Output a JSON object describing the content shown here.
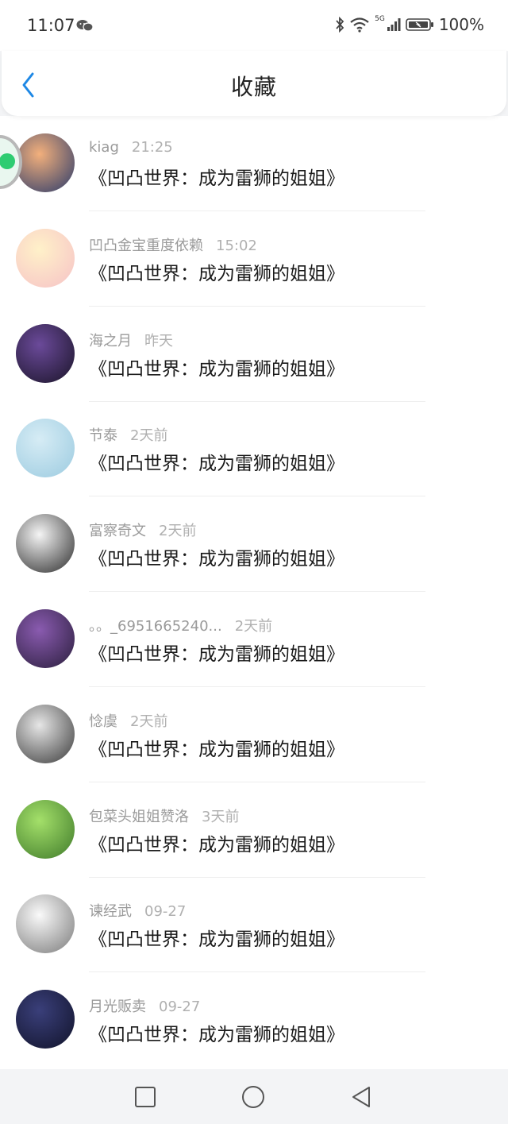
{
  "status_bar": {
    "time": "11:07",
    "battery_percent": "100%",
    "network": "5G",
    "icons": [
      "wechat-icon",
      "bluetooth-icon",
      "wifi-icon",
      "signal-icon",
      "battery-icon"
    ]
  },
  "header": {
    "title": "收藏",
    "back_icon": "chevron-left-icon"
  },
  "accent_color": "#1e88e5",
  "items": [
    {
      "user": "kiag",
      "time": "21:25",
      "title": "《凹凸世界：成为雷狮的姐姐》",
      "avatar_colors": [
        "#f3b07c",
        "#2a3a6a"
      ]
    },
    {
      "user": "凹凸金宝重度依赖",
      "time": "15:02",
      "title": "《凹凸世界：成为雷狮的姐姐》",
      "avatar_colors": [
        "#fff1c9",
        "#f6c2c6"
      ]
    },
    {
      "user": "海之月",
      "time": "昨天",
      "title": "《凹凸世界：成为雷狮的姐姐》",
      "avatar_colors": [
        "#6b4a9a",
        "#1a1428"
      ]
    },
    {
      "user": "节泰",
      "time": "2天前",
      "title": "《凹凸世界：成为雷狮的姐姐》",
      "avatar_colors": [
        "#d6ecf5",
        "#9ccbe0"
      ]
    },
    {
      "user": "富察奇文",
      "time": "2天前",
      "title": "《凹凸世界：成为雷狮的姐姐》",
      "avatar_colors": [
        "#f5f5f5",
        "#2b2b2b"
      ]
    },
    {
      "user": "。。_6951665240...",
      "time": "2天前",
      "title": "《凹凸世界：成为雷狮的姐姐》",
      "avatar_colors": [
        "#8a5bb0",
        "#2a1e3c"
      ]
    },
    {
      "user": "惗虞",
      "time": "2天前",
      "title": "《凹凸世界：成为雷狮的姐姐》",
      "avatar_colors": [
        "#e6e6e6",
        "#3a3a3a"
      ]
    },
    {
      "user": "包菜头姐姐赞洛",
      "time": "3天前",
      "title": "《凹凸世界：成为雷狮的姐姐》",
      "avatar_colors": [
        "#a4e06a",
        "#3f7a2a"
      ]
    },
    {
      "user": "谏经武",
      "time": "09-27",
      "title": "《凹凸世界：成为雷狮的姐姐》",
      "avatar_colors": [
        "#fafafa",
        "#7a7a7a"
      ]
    },
    {
      "user": "月光贩卖",
      "time": "09-27",
      "title": "《凹凸世界：成为雷狮的姐姐》",
      "avatar_colors": [
        "#3a3f7a",
        "#11132a"
      ]
    }
  ],
  "nav_bar": {
    "icons": [
      "square-icon",
      "circle-icon",
      "triangle-back-icon"
    ]
  }
}
